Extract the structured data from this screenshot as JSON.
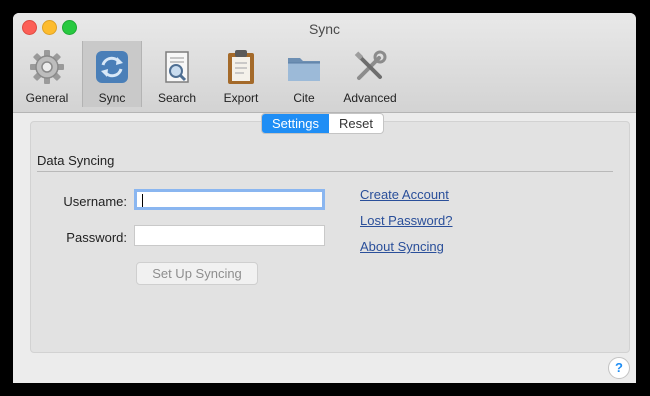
{
  "window": {
    "title": "Sync"
  },
  "toolbar": {
    "items": [
      {
        "label": "General",
        "icon": "gear-icon"
      },
      {
        "label": "Sync",
        "icon": "sync-icon"
      },
      {
        "label": "Search",
        "icon": "search-document-icon"
      },
      {
        "label": "Export",
        "icon": "clipboard-icon"
      },
      {
        "label": "Cite",
        "icon": "folder-icon"
      },
      {
        "label": "Advanced",
        "icon": "tools-icon"
      }
    ],
    "selected": "Sync"
  },
  "tabs": {
    "settings": "Settings",
    "reset": "Reset",
    "active": "Settings"
  },
  "section": {
    "title": "Data Syncing"
  },
  "form": {
    "username_label": "Username:",
    "username_value": "",
    "password_label": "Password:",
    "password_value": "",
    "setup_button": "Set Up Syncing"
  },
  "links": {
    "create_account": "Create Account",
    "lost_password": "Lost Password?",
    "about_syncing": "About Syncing"
  },
  "help": {
    "label": "?"
  },
  "colors": {
    "accent": "#1f8ef5",
    "link": "#2a4f9a"
  }
}
